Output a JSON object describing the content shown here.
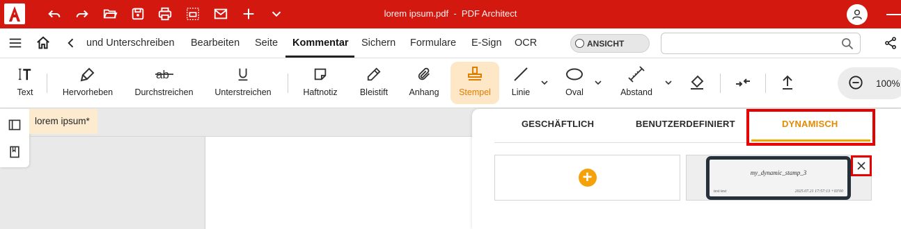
{
  "titlebar": {
    "filename": "lorem ipsum.pdf",
    "separator": "-",
    "app_name": "PDF Architect",
    "bg_color": "#d3180f"
  },
  "menubar": {
    "tabs": [
      {
        "label": "und Unterschreiben"
      },
      {
        "label": "Bearbeiten"
      },
      {
        "label": "Seite"
      },
      {
        "label": "Kommentar",
        "active": true
      },
      {
        "label": "Sichern"
      },
      {
        "label": "Formulare"
      },
      {
        "label": "E-Sign"
      },
      {
        "label": "OCR"
      }
    ],
    "view_toggle_label": "ANSICHT",
    "search_placeholder": ""
  },
  "ribbon": {
    "tools": [
      {
        "label": "Text",
        "icon": "text-tool-icon"
      },
      {
        "label": "Hervorheben",
        "icon": "highlighter-icon"
      },
      {
        "label": "Durchstreichen",
        "icon": "strikethrough-icon"
      },
      {
        "label": "Unterstreichen",
        "icon": "underline-icon"
      },
      {
        "label": "Haftnotiz",
        "icon": "sticky-note-icon"
      },
      {
        "label": "Bleistift",
        "icon": "pencil-icon"
      },
      {
        "label": "Anhang",
        "icon": "paperclip-icon"
      },
      {
        "label": "Stempel",
        "icon": "stamp-icon",
        "active": true
      },
      {
        "label": "Linie",
        "icon": "line-icon"
      },
      {
        "label": "Oval",
        "icon": "oval-icon"
      },
      {
        "label": "Abstand",
        "icon": "distance-icon"
      }
    ],
    "zoom": "100%",
    "accent_color": "#e07d00"
  },
  "document": {
    "tab_label": "lorem ipsum",
    "modified_marker": "*"
  },
  "stamp_panel": {
    "tabs": [
      {
        "label": "GESCHÄFTLICH"
      },
      {
        "label": "BENUTZERDEFINIERT"
      },
      {
        "label": "DYNAMISCH",
        "active": true
      }
    ],
    "add_label": "+",
    "stamp": {
      "name": "my_dynamic_stamp_3",
      "left_text": "test test",
      "right_text": "2025.07.21 17:57:13 +03'00"
    },
    "highlight_color": "#e60000"
  }
}
